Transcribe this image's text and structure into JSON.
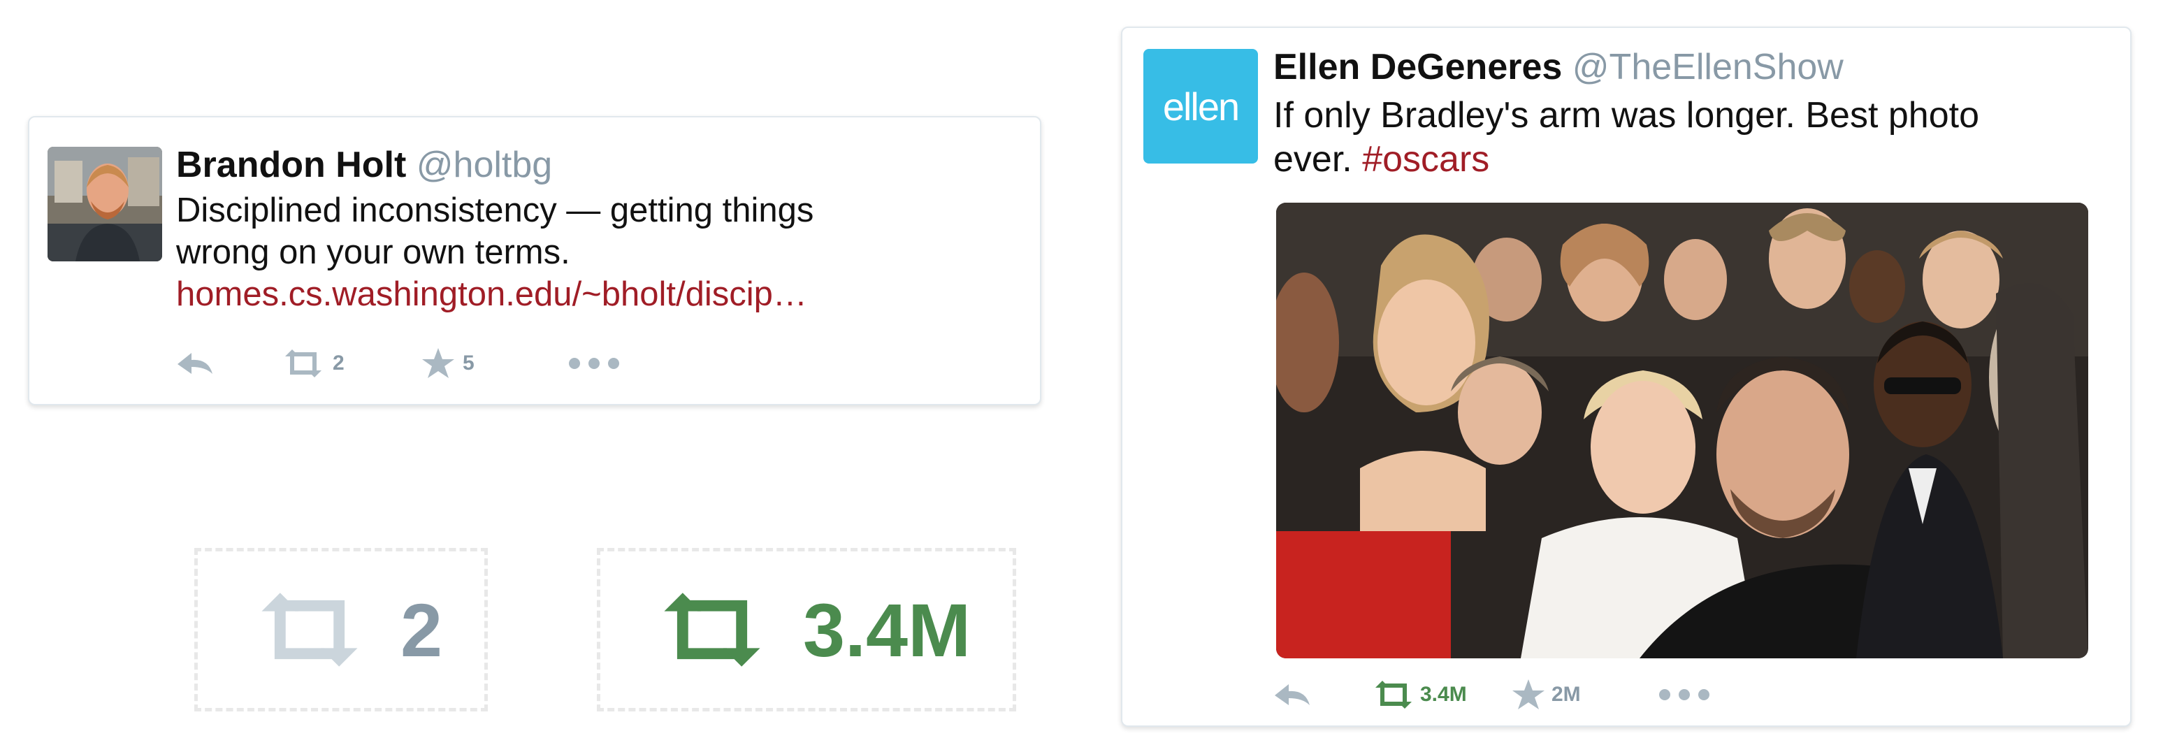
{
  "colors": {
    "link": "#a01d26",
    "retweet_green": "#4b8b4e",
    "muted": "#8899a6",
    "ellen_brand": "#37bde6"
  },
  "tweet_brandon": {
    "name": "Brandon Holt",
    "handle": "@holtbg",
    "text_line1": "Disciplined inconsistency — getting things",
    "text_line2": "wrong on your own terms.",
    "link_text": "homes.cs.washington.edu/~bholt/discip…",
    "retweet_count": "2",
    "favorite_count": "5",
    "icons": [
      "reply-icon",
      "retweet-icon",
      "star-icon",
      "more-icon"
    ]
  },
  "retweet_demo": {
    "small_count": "2",
    "large_count": "3.4M"
  },
  "tweet_ellen": {
    "name": "Ellen DeGeneres",
    "handle": "@TheEllenShow",
    "avatar_text": "ellen",
    "text_line1": "If only Bradley's arm was longer. Best photo",
    "text_line2_prefix": "ever. ",
    "hashtag": "#oscars",
    "retweet_count": "3.4M",
    "favorite_count": "2M",
    "icons": [
      "reply-icon",
      "retweet-icon",
      "star-icon",
      "more-icon"
    ]
  }
}
